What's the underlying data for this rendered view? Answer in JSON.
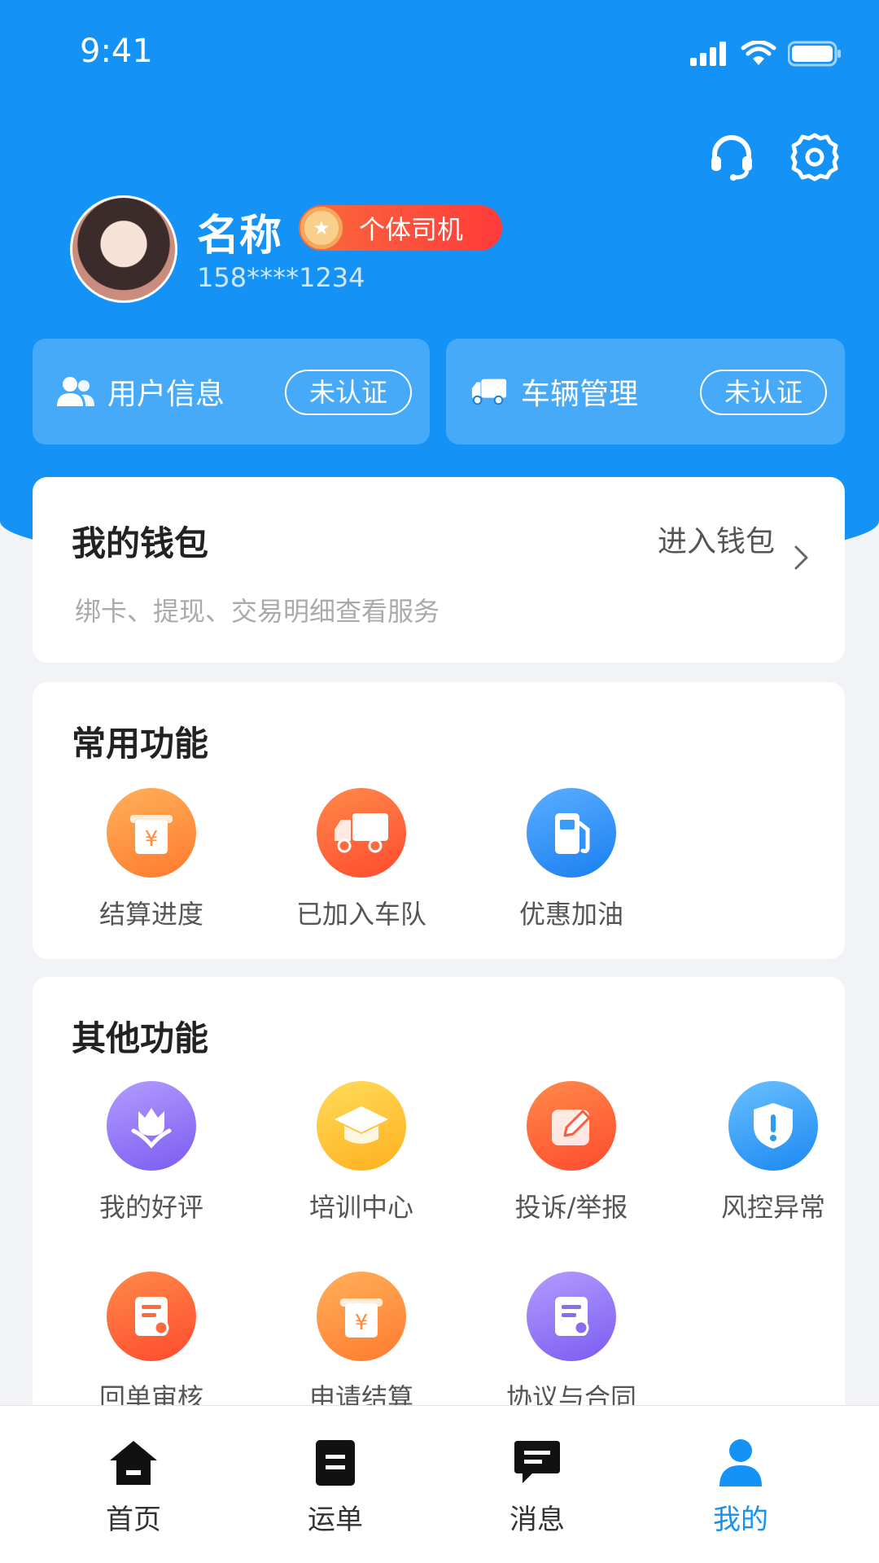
{
  "status_bar": {
    "time": "9:41"
  },
  "profile": {
    "name": "名称",
    "role": "个体司机",
    "phone": "158****1234"
  },
  "auth": {
    "user_info_label": "用户信息",
    "user_info_status": "未认证",
    "vehicle_label": "车辆管理",
    "vehicle_status": "未认证"
  },
  "wallet": {
    "title": "我的钱包",
    "enter_label": "进入钱包",
    "description": "绑卡、提现、交易明细查看服务"
  },
  "common_functions": {
    "title": "常用功能",
    "items": [
      {
        "label": "结算进度",
        "icon": "settlement-icon",
        "color": "#ff8a3c"
      },
      {
        "label": "已加入车队",
        "icon": "truck-icon",
        "color": "#ff5a3c"
      },
      {
        "label": "优惠加油",
        "icon": "fuel-pump-icon",
        "color": "#2d8cf0"
      }
    ]
  },
  "other_functions": {
    "title": "其他功能",
    "items": [
      {
        "label": "我的好评",
        "icon": "tulip-icon",
        "color": "#8a6cf0"
      },
      {
        "label": "培训中心",
        "icon": "graduation-cap-icon",
        "color": "#ffc02e"
      },
      {
        "label": "投诉/举报",
        "icon": "edit-icon",
        "color": "#ff5a3c"
      },
      {
        "label": "风控异常",
        "icon": "shield-alert-icon",
        "color": "#2d9cf0"
      },
      {
        "label": "回单审核",
        "icon": "document-review-icon",
        "color": "#ff5a3c"
      },
      {
        "label": "申请结算",
        "icon": "settlement-icon",
        "color": "#ff8a3c"
      },
      {
        "label": "协议与合同",
        "icon": "contract-icon",
        "color": "#8a6cf0"
      }
    ]
  },
  "tabbar": {
    "items": [
      {
        "label": "首页",
        "icon": "home-icon"
      },
      {
        "label": "运单",
        "icon": "waybill-icon"
      },
      {
        "label": "消息",
        "icon": "message-icon"
      },
      {
        "label": "我的",
        "icon": "person-icon",
        "active": true
      }
    ]
  },
  "colors": {
    "primary": "#1492f6",
    "badge": "#ff4b3b"
  }
}
